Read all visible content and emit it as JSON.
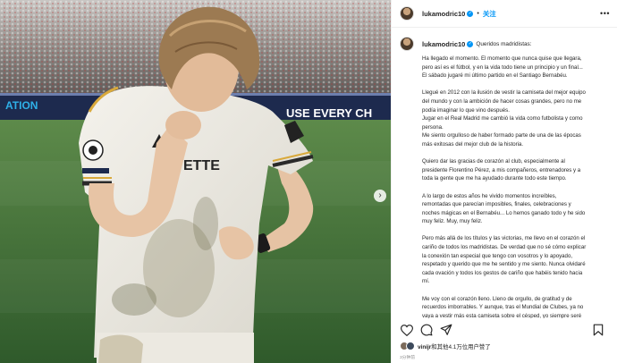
{
  "post": {
    "username": "lukamodric10",
    "follow_label": "关注",
    "caption_greeting": "Queridos madridistas:",
    "caption_paragraphs": [
      "Ha llegado el momento. El momento que nunca quise que llegara,\npero así es el fútbol, y en la vida todo tiene un principio y un final...\nEl sábado jugaré mi último partido en el Santiago Bernabéu.",
      "Llegué en 2012 con la ilusión de vestir la camiseta del mejor equipo\ndel mundo y con la ambición de hacer cosas grandes, pero no me\npodía imaginar lo que vino después.\nJugar en el Real Madrid me cambió la vida como futbolista y como\npersona.\nMe siento orgulloso de haber formado parte de una de las épocas\nmás exitosas del mejor club de la historia.",
      "Quiero dar las gracias de corazón al club, especialmente al\npresidente Florentino Pérez, a mis compañeros, entrenadores y a\ntoda la gente que me ha ayudado durante todo este tiempo.",
      "A lo largo de estos años he vivido momentos increíbles,\nremontadas que parecían imposibles, finales, celebraciones y\nnoches mágicas en el Bernabéu... Lo hemos ganado todo y he sido\nmuy feliz. Muy, muy feliz.",
      "Pero más allá de los títulos y las victorias, me llevo en el corazón el\ncariño de todos los madridistas. De verdad que no sé cómo explicar\nla conexión tan especial que tengo con vosotros y lo apoyado,\nrespetado y querido que me he sentido y me siento. Nunca olvidaré\ncada ovación y todos los gestos de cariño que habéis tenido hacia\nmí.",
      "Me voy con el corazón lleno. Lleno de orgullo, de gratitud y de\nrecuerdos imborrables. Y aunque, tras el Mundial de Clubes, ya no\nvaya a vestir más esta camiseta sobre el césped, yo siempre seré"
    ],
    "likes_user": "vinijr",
    "likes_text": "和其他4.1万位用户",
    "likes_suffix": "赞了",
    "timestamp": "3分钟前"
  },
  "media": {
    "banner_text": "USE EVERY CH",
    "banner_left_text": "ATION"
  },
  "icons": {
    "verified": "verified-badge-icon",
    "more": "more-options-icon",
    "like": "heart-icon",
    "comment": "comment-icon",
    "share": "share-icon",
    "save": "bookmark-icon",
    "next": "chevron-right-icon"
  },
  "colors": {
    "accent": "#0095f6",
    "text": "#262626",
    "muted": "#8e8e8e",
    "pitch": "#3f6b38"
  }
}
